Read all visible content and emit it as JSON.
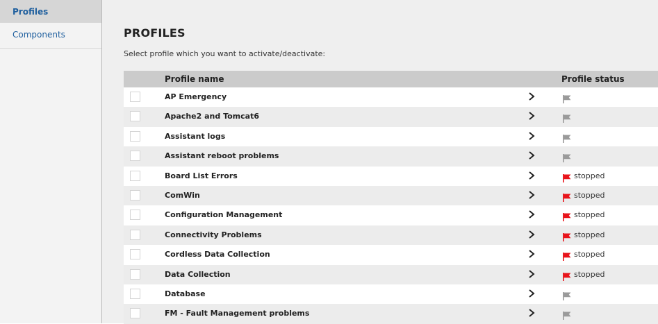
{
  "sidebar": {
    "items": [
      {
        "label": "Profiles",
        "active": true
      },
      {
        "label": "Components",
        "active": false
      }
    ]
  },
  "main": {
    "title": "PROFILES",
    "subtitle": "Select profile which you want to activate/deactivate:",
    "columns": {
      "name": "Profile name",
      "status": "Profile status"
    },
    "rows": [
      {
        "name": "AP Emergency",
        "status": "",
        "flag": "gray-flag-icon"
      },
      {
        "name": "Apache2 and Tomcat6",
        "status": "",
        "flag": "gray-flag-icon"
      },
      {
        "name": "Assistant logs",
        "status": "",
        "flag": "gray-flag-icon"
      },
      {
        "name": "Assistant reboot problems",
        "status": "",
        "flag": "gray-flag-icon"
      },
      {
        "name": "Board List Errors",
        "status": "stopped",
        "flag": "red-flag-icon"
      },
      {
        "name": "ComWin",
        "status": "stopped",
        "flag": "red-flag-icon"
      },
      {
        "name": "Configuration Management",
        "status": "stopped",
        "flag": "red-flag-icon"
      },
      {
        "name": "Connectivity Problems",
        "status": "stopped",
        "flag": "red-flag-icon"
      },
      {
        "name": "Cordless Data Collection",
        "status": "stopped",
        "flag": "red-flag-icon"
      },
      {
        "name": "Data Collection",
        "status": "stopped",
        "flag": "red-flag-icon"
      },
      {
        "name": "Database",
        "status": "",
        "flag": "gray-flag-icon"
      },
      {
        "name": "FM - Fault Management problems",
        "status": "",
        "flag": "gray-flag-icon"
      }
    ]
  },
  "colors": {
    "link": "#1f5f9e",
    "flag_red": "#e8141b",
    "flag_gray": "#9a9a9a",
    "header_bg": "#cbcbcb"
  }
}
